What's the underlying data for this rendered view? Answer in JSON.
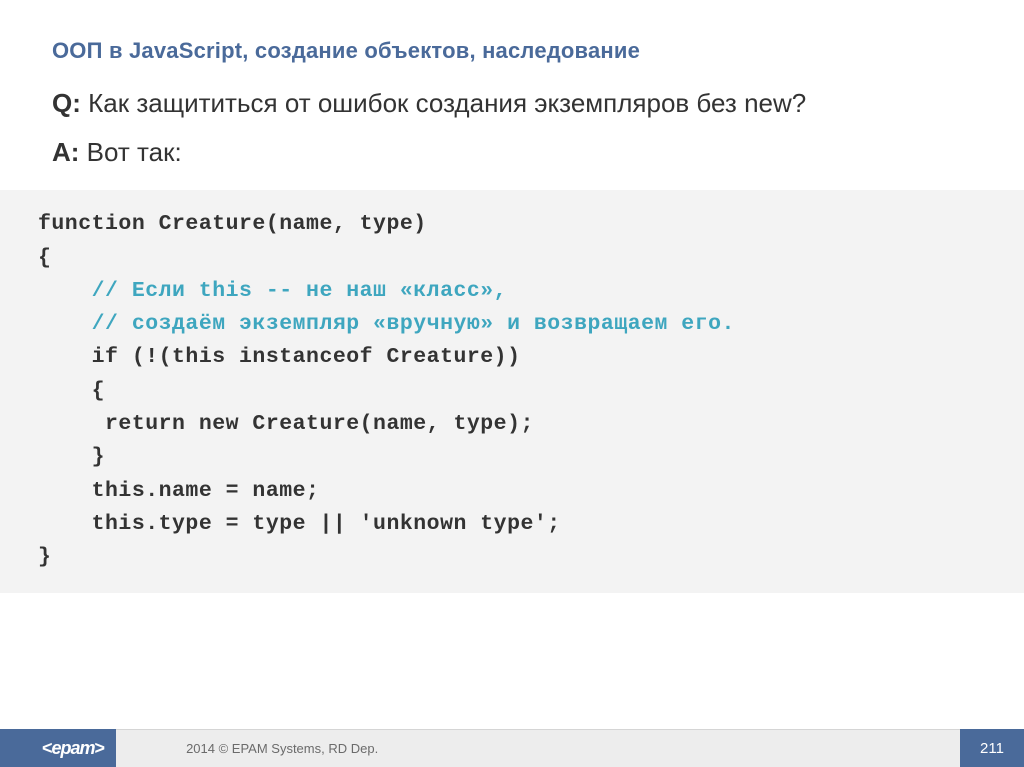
{
  "title": "ООП в JavaScript, создание объектов, наследование",
  "question_label": "Q:",
  "question_text": "Как защититься от ошибок создания экземпляров без new?",
  "answer_label": "A:",
  "answer_text": "Вот так:",
  "code": {
    "l1": "function Creature(name, type)",
    "l2": "{",
    "l3_indent": "    ",
    "l3": "// Если this -- не наш «класс»,",
    "l4_indent": "    ",
    "l4": "// создаём экземпляр «вручную» и возвращаем его.",
    "l5": "    if (!(this instanceof Creature))",
    "l6": "    {",
    "l7": "     return new Creature(name, type);",
    "l8": "    }",
    "l9": "",
    "l10": "    this.name = name;",
    "l11": "    this.type = type || 'unknown type';",
    "l12": "}"
  },
  "footer": {
    "logo_open": "<",
    "logo_text": "epam",
    "logo_close": ">",
    "copyright": "2014 © EPAM Systems, RD Dep.",
    "page": "211"
  }
}
